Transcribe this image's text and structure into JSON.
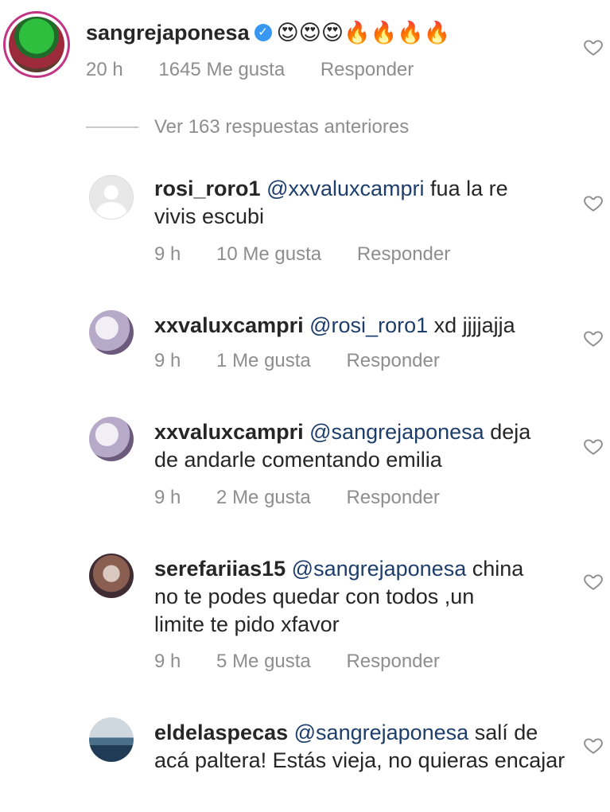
{
  "main_comment": {
    "username": "sangrejaponesa",
    "text": "😍😍😍🔥🔥🔥🔥",
    "time": "20 h",
    "likes": "1645 Me gusta",
    "reply_label": "Responder"
  },
  "view_previous": "Ver 163 respuestas anteriores",
  "replies": [
    {
      "username": "rosi_roro1",
      "mention": "@xxvaluxcampri",
      "text": "fua la re vivis escubi",
      "time": "9 h",
      "likes": "10 Me gusta",
      "reply_label": "Responder"
    },
    {
      "username": "xxvaluxcampri",
      "mention": "@rosi_roro1",
      "text": "xd jjjjajja",
      "time": "9 h",
      "likes": "1 Me gusta",
      "reply_label": "Responder"
    },
    {
      "username": "xxvaluxcampri",
      "mention": "@sangrejaponesa",
      "text": "deja de andarle comentando emilia",
      "time": "9 h",
      "likes": "2 Me gusta",
      "reply_label": "Responder"
    },
    {
      "username": "serefariias15",
      "mention": "@sangrejaponesa",
      "text": "china no te podes quedar con todos ,un limite te pido xfavor",
      "time": "9 h",
      "likes": "5 Me gusta",
      "reply_label": "Responder"
    },
    {
      "username": "eldelaspecas",
      "mention": "@sangrejaponesa",
      "text": "salí de acá paltera! Estás vieja, no quieras encajar",
      "time": "",
      "likes": "",
      "reply_label": ""
    }
  ],
  "colors": {
    "mention": "#1d3d6b",
    "meta": "#8e8e8e",
    "verified": "#3897f0"
  }
}
